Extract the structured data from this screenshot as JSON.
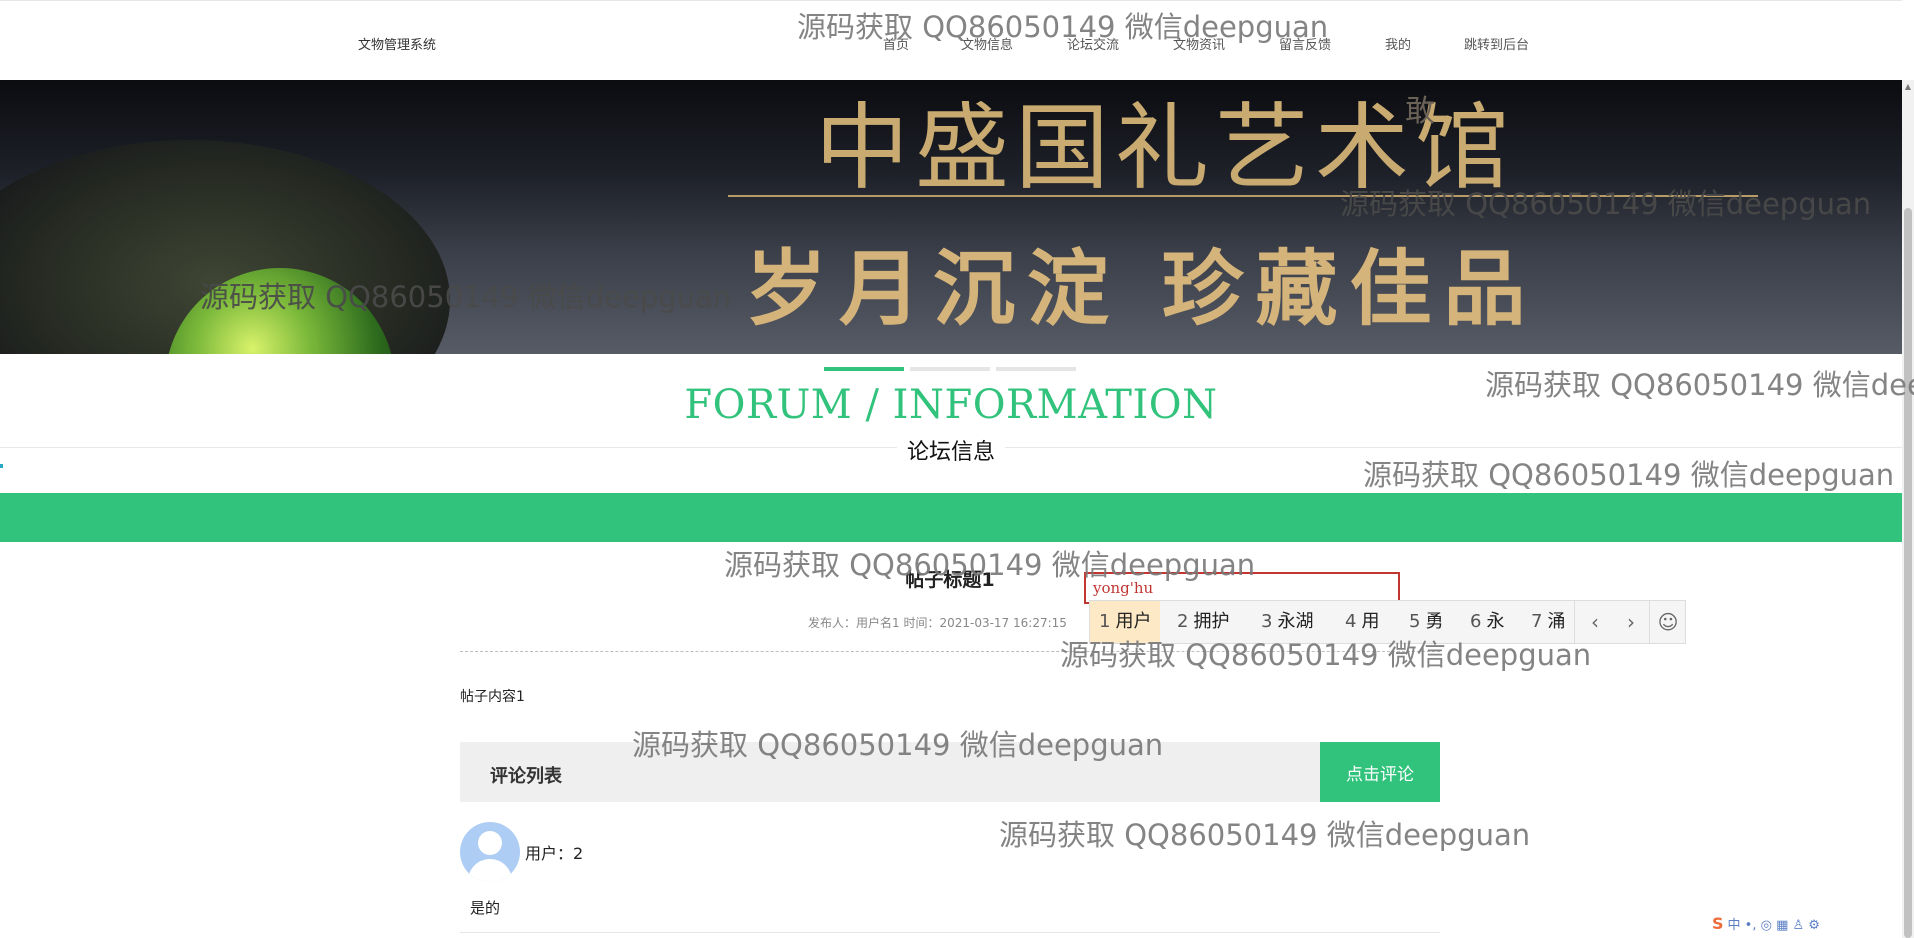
{
  "header": {
    "brand": "文物管理系统",
    "nav": [
      "首页",
      "文物信息",
      "论坛交流",
      "文物资讯",
      "留言反馈",
      "我的",
      "跳转到后台"
    ]
  },
  "banner": {
    "title": "中盛国礼艺术馆",
    "subtitle": "岁月沉淀 珍藏佳品",
    "ghost": "敢",
    "slides": 3,
    "active_slide": 1
  },
  "section": {
    "title": "FORUM / INFORMATION",
    "subtitle": "论坛信息"
  },
  "post": {
    "title": "帖子标题1",
    "meta": "发布人：用户名1 时间：2021-03-17 16:27:15",
    "content": "帖子内容1"
  },
  "comments": {
    "header": "评论列表",
    "button": "点击评论",
    "items": [
      {
        "user": "用户：2",
        "text": "是的"
      }
    ]
  },
  "ime": {
    "composition": "yong'hu",
    "candidates": [
      {
        "num": "1",
        "text": "用户"
      },
      {
        "num": "2",
        "text": "拥护"
      },
      {
        "num": "3",
        "text": "永湖"
      },
      {
        "num": "4",
        "text": "用"
      },
      {
        "num": "5",
        "text": "勇"
      },
      {
        "num": "6",
        "text": "永"
      },
      {
        "num": "7",
        "text": "涌"
      }
    ],
    "prev": "‹",
    "next": "›",
    "emoji": "☺"
  },
  "tray": {
    "logo": "S",
    "items": "中 •, ◎ ▦ ♙ ⚙"
  },
  "watermark": "源码获取 QQ86050149 微信deepguan",
  "colors": {
    "accent": "#31c27c",
    "ime_border": "#c23531",
    "ime_selected": "#fde9c6"
  }
}
